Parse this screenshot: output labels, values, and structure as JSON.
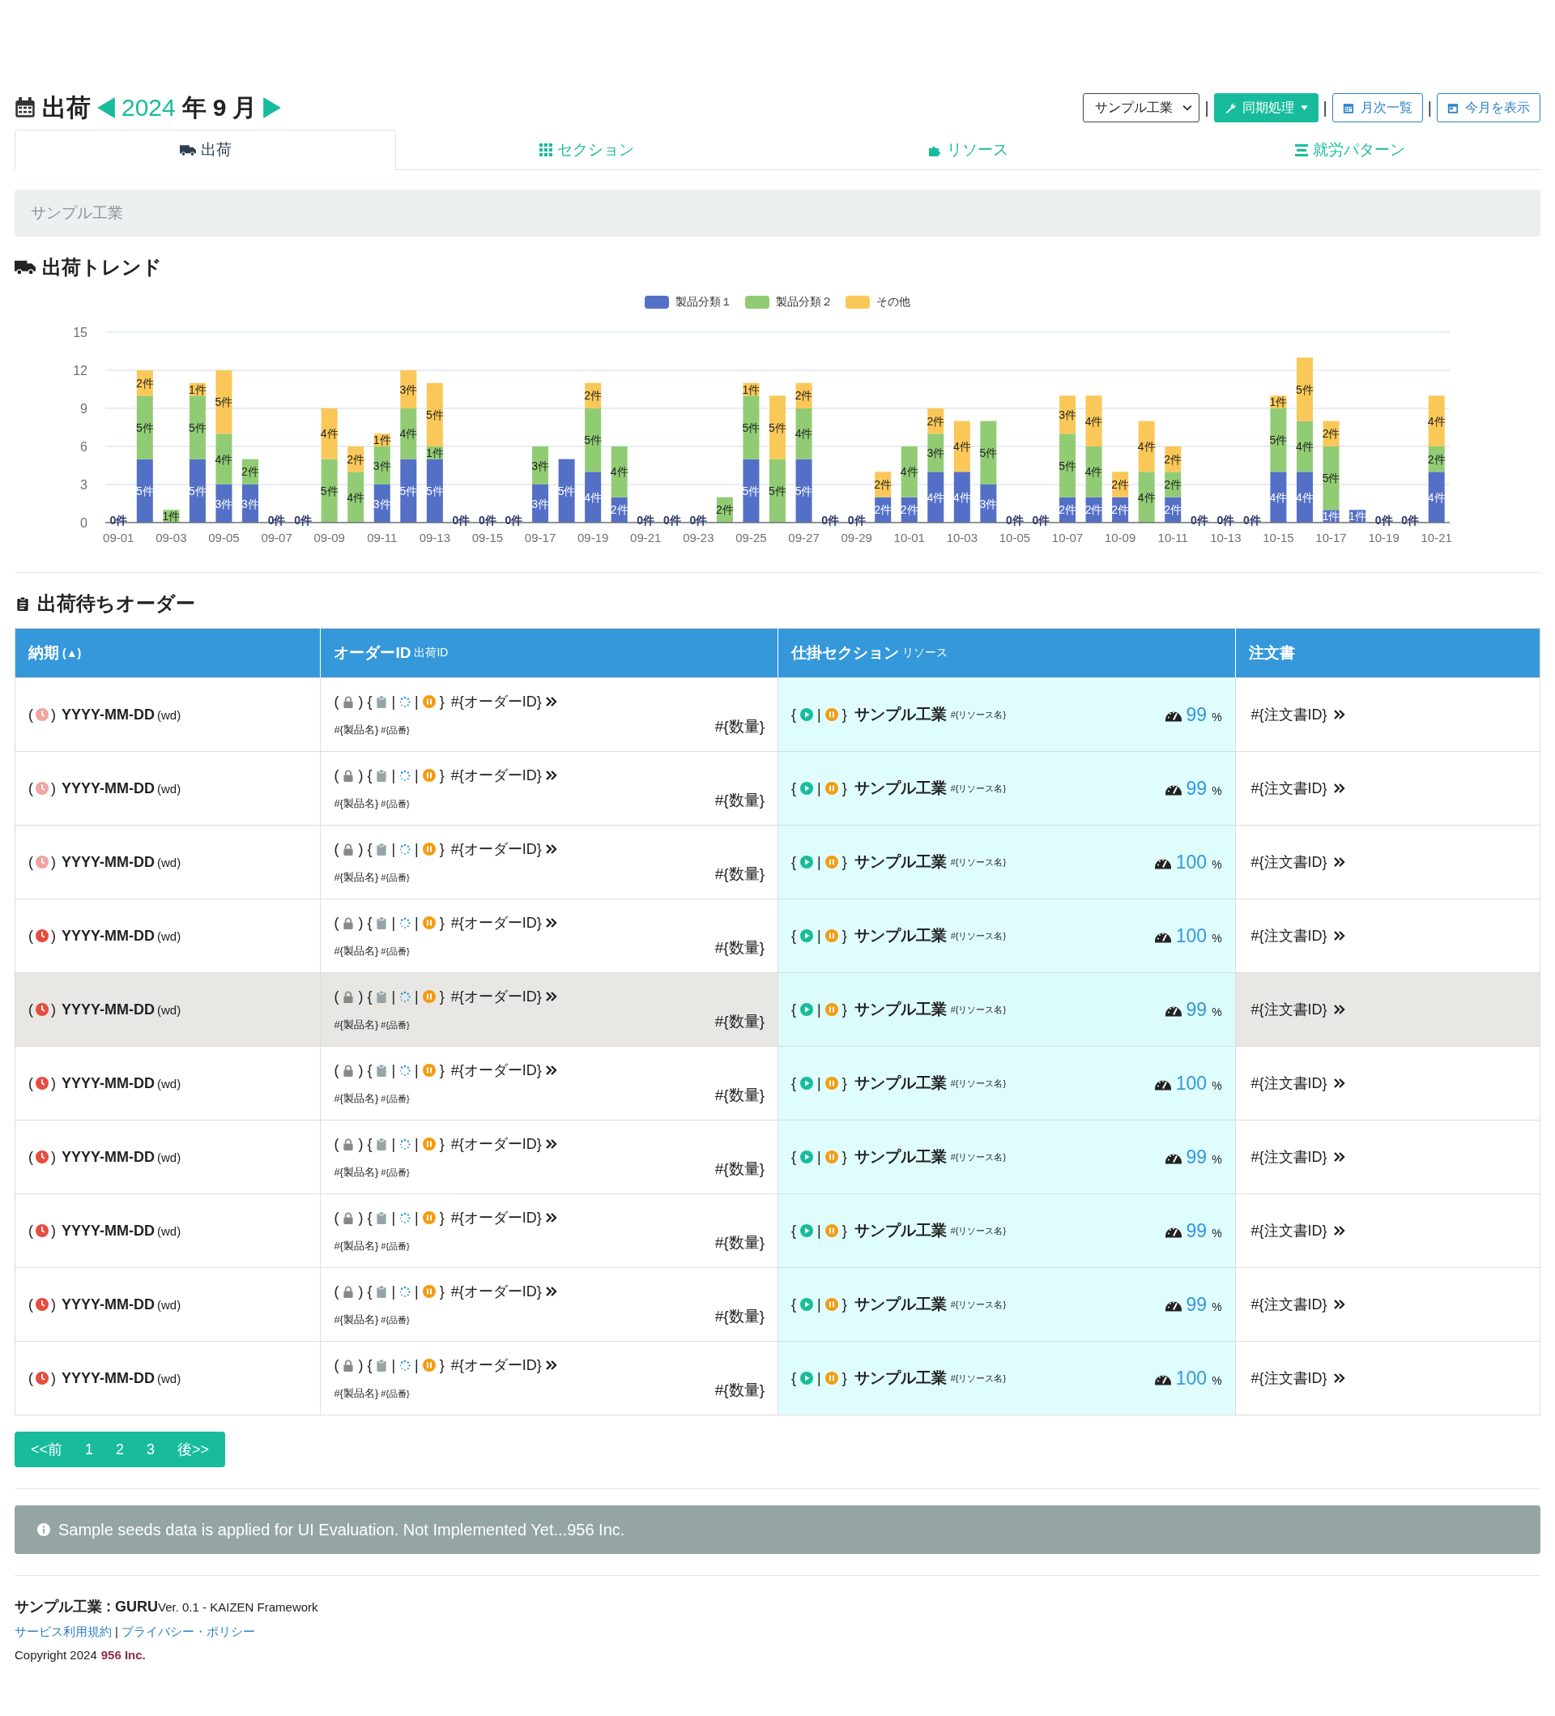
{
  "header": {
    "title": "出荷",
    "year": "2024",
    "year_unit": "年",
    "month": "9",
    "month_unit": "月"
  },
  "toolbar": {
    "factory_select": "サンプル工業",
    "separators": [
      "|",
      "|",
      "|"
    ],
    "sync_button": "同期処理",
    "monthly_button": "月次一覧",
    "this_month_button": "今月を表示"
  },
  "tabs": [
    {
      "label": "出荷",
      "selected": true
    },
    {
      "label": "セクション",
      "selected": false
    },
    {
      "label": "リソース",
      "selected": false
    },
    {
      "label": "就労パターン",
      "selected": false
    }
  ],
  "filter": {
    "placeholder": "サンプル工業"
  },
  "trend": {
    "title": "出荷トレンド",
    "chart_data": {
      "type": "bar",
      "stacked": true,
      "grid": true,
      "categories": [
        "09-01",
        null,
        "09-03",
        null,
        "09-05",
        null,
        "09-07",
        null,
        "09-09",
        null,
        "09-11",
        null,
        "09-13",
        null,
        "09-15",
        null,
        "09-17",
        null,
        "09-19",
        null,
        "09-21",
        null,
        "09-23",
        null,
        "09-25",
        null,
        "09-27",
        null,
        "09-29",
        null,
        "10-01",
        null,
        "10-03",
        null,
        "10-05",
        null,
        "10-07",
        null,
        "10-09",
        null,
        "10-11",
        null,
        "10-13",
        null,
        "10-15",
        null,
        "10-17",
        null,
        "10-19",
        null,
        "10-21"
      ],
      "ylim": [
        0,
        15
      ],
      "yticks": [
        0,
        3,
        6,
        9,
        12,
        15
      ],
      "value_labels": [
        [
          "0件",
          "5件",
          null,
          "5件",
          "3件",
          "3件",
          "0件",
          "0件",
          null,
          null,
          "3件",
          "5件",
          "5件",
          "0件",
          "0件",
          "0件",
          "3件",
          "5件",
          "4件",
          "2件",
          "0件",
          "0件",
          "0件",
          null,
          "5件",
          null,
          "5件",
          "0件",
          "0件",
          "2件",
          "2件",
          "4件",
          "4件",
          "3件",
          "0件",
          "0件",
          "2件",
          "2件",
          "2件",
          null,
          "2件",
          "0件",
          "0件",
          "0件",
          "4件",
          "4件",
          "1件",
          "1件",
          "0件",
          "0件",
          "4件"
        ],
        [
          null,
          "5件",
          "1件",
          "5件",
          "4件",
          "2件",
          null,
          null,
          "5件",
          "4件",
          "3件",
          "4件",
          "1件",
          null,
          null,
          null,
          "3件",
          null,
          "5件",
          "4件",
          null,
          null,
          null,
          "2件",
          "5件",
          "5件",
          "4件",
          null,
          null,
          null,
          "4件",
          "3件",
          null,
          "5件",
          null,
          null,
          "5件",
          "4件",
          null,
          "4件",
          "2件",
          null,
          null,
          null,
          "5件",
          "4件",
          "5件",
          null,
          null,
          null,
          "2件"
        ],
        [
          null,
          "2件",
          null,
          "1件",
          "5件",
          null,
          null,
          null,
          "4件",
          "2件",
          "1件",
          "3件",
          "5件",
          null,
          null,
          null,
          null,
          null,
          "2件",
          null,
          null,
          null,
          null,
          null,
          "1件",
          "5件",
          "2件",
          null,
          null,
          "2件",
          null,
          "2件",
          "4件",
          null,
          null,
          null,
          "3件",
          "4件",
          "2件",
          "4件",
          "2件",
          null,
          null,
          null,
          "1件",
          "5件",
          "2件",
          null,
          null,
          null,
          "4件"
        ]
      ],
      "series": [
        {
          "name": "製品分類１",
          "color": "#5470c6",
          "values": [
            0,
            5,
            0,
            5,
            3,
            3,
            0,
            0,
            0,
            0,
            3,
            5,
            5,
            0,
            0,
            0,
            3,
            5,
            4,
            2,
            0,
            0,
            0,
            0,
            5,
            0,
            5,
            0,
            0,
            2,
            2,
            4,
            4,
            3,
            0,
            0,
            2,
            2,
            2,
            0,
            2,
            0,
            0,
            0,
            4,
            4,
            1,
            1,
            0,
            0,
            4
          ]
        },
        {
          "name": "製品分類２",
          "color": "#91cc75",
          "values": [
            0,
            5,
            1,
            5,
            4,
            2,
            0,
            0,
            5,
            4,
            3,
            4,
            1,
            0,
            0,
            0,
            3,
            0,
            5,
            4,
            0,
            0,
            0,
            2,
            5,
            5,
            4,
            0,
            0,
            0,
            4,
            3,
            0,
            5,
            0,
            0,
            5,
            4,
            0,
            4,
            2,
            0,
            0,
            0,
            5,
            4,
            5,
            0,
            0,
            0,
            2
          ]
        },
        {
          "name": "その他",
          "color": "#fac858",
          "values": [
            0,
            2,
            0,
            1,
            5,
            0,
            0,
            0,
            4,
            2,
            1,
            3,
            5,
            0,
            0,
            0,
            0,
            0,
            2,
            0,
            0,
            0,
            0,
            0,
            1,
            5,
            2,
            0,
            0,
            2,
            0,
            2,
            4,
            0,
            0,
            0,
            3,
            4,
            2,
            4,
            2,
            0,
            0,
            0,
            1,
            5,
            2,
            0,
            0,
            0,
            4
          ]
        }
      ]
    }
  },
  "orders": {
    "title": "出荷待ちオーダー",
    "columns": [
      {
        "label": "納期",
        "sub": "(▲)"
      },
      {
        "label": "オーダーID",
        "sub": "出荷ID"
      },
      {
        "label": "仕掛セクション",
        "sub": "リソース"
      },
      {
        "label": "注文書"
      }
    ],
    "rows": [
      {
        "urgent": false,
        "hovered": false,
        "date_marks": [
          "(",
          ")"
        ],
        "date": "YYYY-MM-DD",
        "weekday": "(wd)",
        "order_marks": [
          "(",
          ")",
          "{",
          "|",
          "|",
          "}"
        ],
        "order_id": "#{オーダーID}",
        "product": "#{製品名}",
        "part_no": "#{品番}",
        "quantity": "#{数量}",
        "section_marks": [
          "{",
          "|",
          "}"
        ],
        "section": "サンプル工業",
        "resource": "#{リソース名}",
        "rate": "99",
        "rate_unit": "%",
        "order_doc": "#{注文書ID}"
      },
      {
        "urgent": false,
        "hovered": false,
        "date_marks": [
          "(",
          ")"
        ],
        "date": "YYYY-MM-DD",
        "weekday": "(wd)",
        "order_marks": [
          "(",
          ")",
          "{",
          "|",
          "|",
          "}"
        ],
        "order_id": "#{オーダーID}",
        "product": "#{製品名}",
        "part_no": "#{品番}",
        "quantity": "#{数量}",
        "section_marks": [
          "{",
          "|",
          "}"
        ],
        "section": "サンプル工業",
        "resource": "#{リソース名}",
        "rate": "99",
        "rate_unit": "%",
        "order_doc": "#{注文書ID}"
      },
      {
        "urgent": false,
        "hovered": false,
        "date_marks": [
          "(",
          ")"
        ],
        "date": "YYYY-MM-DD",
        "weekday": "(wd)",
        "order_marks": [
          "(",
          ")",
          "{",
          "|",
          "|",
          "}"
        ],
        "order_id": "#{オーダーID}",
        "product": "#{製品名}",
        "part_no": "#{品番}",
        "quantity": "#{数量}",
        "section_marks": [
          "{",
          "|",
          "}"
        ],
        "section": "サンプル工業",
        "resource": "#{リソース名}",
        "rate": "100",
        "rate_unit": "%",
        "order_doc": "#{注文書ID}"
      },
      {
        "urgent": true,
        "hovered": false,
        "date_marks": [
          "(",
          ")"
        ],
        "date": "YYYY-MM-DD",
        "weekday": "(wd)",
        "order_marks": [
          "(",
          ")",
          "{",
          "|",
          "|",
          "}"
        ],
        "order_id": "#{オーダーID}",
        "product": "#{製品名}",
        "part_no": "#{品番}",
        "quantity": "#{数量}",
        "section_marks": [
          "{",
          "|",
          "}"
        ],
        "section": "サンプル工業",
        "resource": "#{リソース名}",
        "rate": "100",
        "rate_unit": "%",
        "order_doc": "#{注文書ID}"
      },
      {
        "urgent": true,
        "hovered": true,
        "date_marks": [
          "(",
          ")"
        ],
        "date": "YYYY-MM-DD",
        "weekday": "(wd)",
        "order_marks": [
          "(",
          ")",
          "{",
          "|",
          "|",
          "}"
        ],
        "order_id": "#{オーダーID}",
        "product": "#{製品名}",
        "part_no": "#{品番}",
        "quantity": "#{数量}",
        "section_marks": [
          "{",
          "|",
          "}"
        ],
        "section": "サンプル工業",
        "resource": "#{リソース名}",
        "rate": "99",
        "rate_unit": "%",
        "order_doc": "#{注文書ID}"
      },
      {
        "urgent": true,
        "hovered": false,
        "date_marks": [
          "(",
          ")"
        ],
        "date": "YYYY-MM-DD",
        "weekday": "(wd)",
        "order_marks": [
          "(",
          ")",
          "{",
          "|",
          "|",
          "}"
        ],
        "order_id": "#{オーダーID}",
        "product": "#{製品名}",
        "part_no": "#{品番}",
        "quantity": "#{数量}",
        "section_marks": [
          "{",
          "|",
          "}"
        ],
        "section": "サンプル工業",
        "resource": "#{リソース名}",
        "rate": "100",
        "rate_unit": "%",
        "order_doc": "#{注文書ID}"
      },
      {
        "urgent": true,
        "hovered": false,
        "date_marks": [
          "(",
          ")"
        ],
        "date": "YYYY-MM-DD",
        "weekday": "(wd)",
        "order_marks": [
          "(",
          ")",
          "{",
          "|",
          "|",
          "}"
        ],
        "order_id": "#{オーダーID}",
        "product": "#{製品名}",
        "part_no": "#{品番}",
        "quantity": "#{数量}",
        "section_marks": [
          "{",
          "|",
          "}"
        ],
        "section": "サンプル工業",
        "resource": "#{リソース名}",
        "rate": "99",
        "rate_unit": "%",
        "order_doc": "#{注文書ID}"
      },
      {
        "urgent": true,
        "hovered": false,
        "date_marks": [
          "(",
          ")"
        ],
        "date": "YYYY-MM-DD",
        "weekday": "(wd)",
        "order_marks": [
          "(",
          ")",
          "{",
          "|",
          "|",
          "}"
        ],
        "order_id": "#{オーダーID}",
        "product": "#{製品名}",
        "part_no": "#{品番}",
        "quantity": "#{数量}",
        "section_marks": [
          "{",
          "|",
          "}"
        ],
        "section": "サンプル工業",
        "resource": "#{リソース名}",
        "rate": "99",
        "rate_unit": "%",
        "order_doc": "#{注文書ID}"
      },
      {
        "urgent": true,
        "hovered": false,
        "date_marks": [
          "(",
          ")"
        ],
        "date": "YYYY-MM-DD",
        "weekday": "(wd)",
        "order_marks": [
          "(",
          ")",
          "{",
          "|",
          "|",
          "}"
        ],
        "order_id": "#{オーダーID}",
        "product": "#{製品名}",
        "part_no": "#{品番}",
        "quantity": "#{数量}",
        "section_marks": [
          "{",
          "|",
          "}"
        ],
        "section": "サンプル工業",
        "resource": "#{リソース名}",
        "rate": "99",
        "rate_unit": "%",
        "order_doc": "#{注文書ID}"
      },
      {
        "urgent": true,
        "hovered": false,
        "date_marks": [
          "(",
          ")"
        ],
        "date": "YYYY-MM-DD",
        "weekday": "(wd)",
        "order_marks": [
          "(",
          ")",
          "{",
          "|",
          "|",
          "}"
        ],
        "order_id": "#{オーダーID}",
        "product": "#{製品名}",
        "part_no": "#{品番}",
        "quantity": "#{数量}",
        "section_marks": [
          "{",
          "|",
          "}"
        ],
        "section": "サンプル工業",
        "resource": "#{リソース名}",
        "rate": "100",
        "rate_unit": "%",
        "order_doc": "#{注文書ID}"
      }
    ]
  },
  "pagination": {
    "prev": "<<前",
    "pages": [
      "1",
      "2",
      "3"
    ],
    "next": "後>>"
  },
  "alert": {
    "text": "Sample seeds data is applied for UI Evaluation. Not Implemented Yet...956 Inc."
  },
  "footer": {
    "brand": "サンプル工業 : GURU",
    "version": "Ver. 0.1 - KAIZEN Framework",
    "links": [
      "サービス利用規約",
      "プライバシー・ポリシー"
    ],
    "link_separator": "|",
    "copyright": "Copyright 2024",
    "company": "956 Inc."
  }
}
